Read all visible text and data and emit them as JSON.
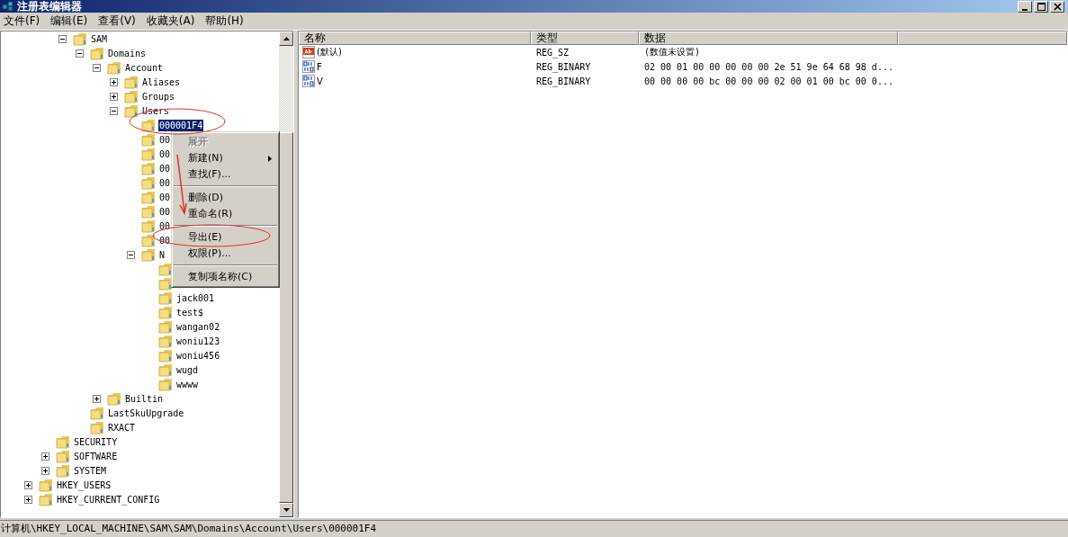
{
  "window": {
    "title": "注册表编辑器"
  },
  "menu_bar": [
    "文件(F)",
    "编辑(E)",
    "查看(V)",
    "收藏夹(A)",
    "帮助(H)"
  ],
  "tree": [
    {
      "kind": "offscreen",
      "children": [
        {
          "kind": "offscreen",
          "children": [
            {
              "kind": "key",
              "label": "SAM",
              "expanded": true,
              "selected": false,
              "children": [
                {
                  "kind": "key",
                  "label": "Domains",
                  "expanded": true,
                  "selected": false,
                  "children": [
                    {
                      "kind": "key",
                      "label": "Account",
                      "expanded": true,
                      "selected": false,
                      "children": [
                        {
                          "kind": "key",
                          "label": "Aliases",
                          "expanded": false,
                          "selected": false
                        },
                        {
                          "kind": "key",
                          "label": "Groups",
                          "expanded": false,
                          "selected": false
                        },
                        {
                          "kind": "key",
                          "label": "Users",
                          "expanded": true,
                          "selected": false,
                          "children": [
                            {
                              "kind": "key",
                              "label": "000001F4",
                              "selected": true
                            },
                            {
                              "kind": "key",
                              "label": "00",
                              "selected": false
                            },
                            {
                              "kind": "key",
                              "label": "00",
                              "selected": false
                            },
                            {
                              "kind": "key",
                              "label": "00",
                              "selected": false
                            },
                            {
                              "kind": "key",
                              "label": "00",
                              "selected": false
                            },
                            {
                              "kind": "key",
                              "label": "00",
                              "selected": false
                            },
                            {
                              "kind": "key",
                              "label": "00",
                              "selected": false
                            },
                            {
                              "kind": "key",
                              "label": "00",
                              "selected": false
                            },
                            {
                              "kind": "key",
                              "label": "00",
                              "selected": false
                            },
                            {
                              "kind": "key",
                              "label": "N",
                              "expanded": true,
                              "selected": false,
                              "children": [
                                {
                                  "kind": "key"
                                },
                                {
                                  "kind": "key"
                                },
                                {
                                  "kind": "key",
                                  "label": "jack001",
                                  "selected": false
                                },
                                {
                                  "kind": "key",
                                  "label": "test$",
                                  "selected": false
                                },
                                {
                                  "kind": "key",
                                  "label": "wangan02",
                                  "selected": false
                                },
                                {
                                  "kind": "key",
                                  "label": "woniu123",
                                  "selected": false
                                },
                                {
                                  "kind": "key",
                                  "label": "woniu456",
                                  "selected": false
                                },
                                {
                                  "kind": "key",
                                  "label": "wugd",
                                  "selected": false
                                },
                                {
                                  "kind": "key",
                                  "label": "wwww",
                                  "selected": false
                                }
                              ]
                            }
                          ]
                        }
                      ]
                    },
                    {
                      "kind": "key",
                      "label": "Builtin",
                      "expanded": false,
                      "selected": false
                    }
                  ]
                },
                {
                  "kind": "key",
                  "label": "LastSkuUpgrade",
                  "selected": false
                },
                {
                  "kind": "key",
                  "label": "RXACT",
                  "selected": false
                }
              ]
            }
          ]
        },
        {
          "kind": "key",
          "label": "SECURITY",
          "selected": false
        },
        {
          "kind": "key",
          "label": "SOFTWARE",
          "expanded": false,
          "selected": false
        },
        {
          "kind": "key",
          "label": "SYSTEM",
          "expanded": false,
          "selected": false
        }
      ]
    },
    {
      "kind": "key",
      "label": "HKEY_USERS",
      "expanded": false,
      "selected": false
    },
    {
      "kind": "key",
      "label": "HKEY_CURRENT_CONFIG",
      "expanded": false,
      "selected": false
    }
  ],
  "values_table": {
    "columns": [
      "名称",
      "类型",
      "数据"
    ],
    "rows": [
      {
        "kind": "string",
        "name": "(默认)",
        "type": "REG_SZ",
        "data": "(数值未设置)"
      },
      {
        "kind": "binary",
        "name": "F",
        "type": "REG_BINARY",
        "data": "02 00 01 00 00 00 00 00 2e 51 9e 64 68 98 d..."
      },
      {
        "kind": "binary",
        "name": "V",
        "type": "REG_BINARY",
        "data": "00 00 00 00 bc 00 00 00 02 00 01 00 bc 00 0..."
      }
    ]
  },
  "context_menu": [
    {
      "kind": "item",
      "label": "展开",
      "disabled": true,
      "default": true,
      "submenu": false
    },
    {
      "kind": "item",
      "label": "新建(N)",
      "disabled": false,
      "default": false,
      "submenu": true
    },
    {
      "kind": "item",
      "label": "查找(F)...",
      "disabled": false,
      "default": false,
      "submenu": false
    },
    {
      "kind": "separator"
    },
    {
      "kind": "item",
      "label": "删除(D)",
      "disabled": false,
      "default": false,
      "submenu": false
    },
    {
      "kind": "item",
      "label": "重命名(R)",
      "disabled": false,
      "default": false,
      "submenu": false
    },
    {
      "kind": "separator"
    },
    {
      "kind": "item",
      "label": "导出(E)",
      "disabled": false,
      "default": false,
      "submenu": false
    },
    {
      "kind": "item",
      "label": "权限(P)...",
      "disabled": false,
      "default": false,
      "submenu": false
    },
    {
      "kind": "separator"
    },
    {
      "kind": "item",
      "label": "复制项名称(C)",
      "disabled": false,
      "default": false,
      "submenu": false
    }
  ],
  "status_bar": "计算机\\HKEY_LOCAL_MACHINE\\SAM\\SAM\\Domains\\Account\\Users\\000001F4"
}
